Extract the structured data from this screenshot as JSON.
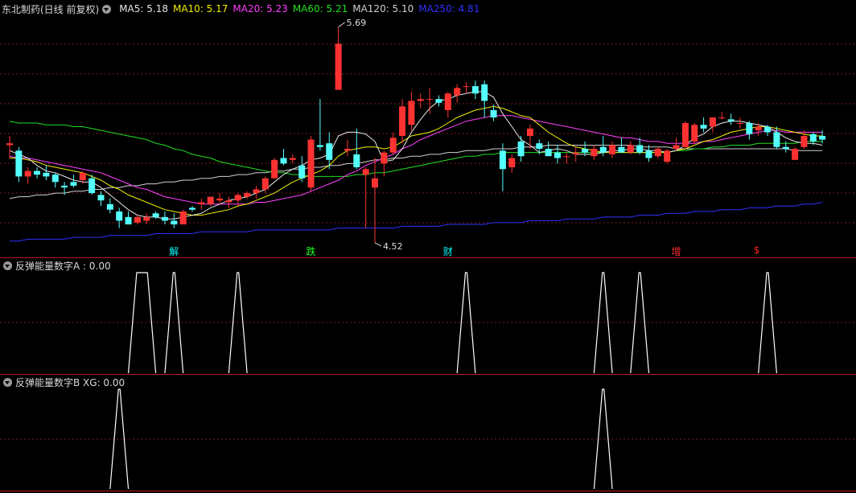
{
  "main_panel": {
    "title": "东北制药(日线 前复权)",
    "ma_legend": [
      {
        "label": "MA5: 5.18",
        "color": "#e8e8e8"
      },
      {
        "label": "MA10: 5.17",
        "color": "#f0f000"
      },
      {
        "label": "MA20: 5.23",
        "color": "#ff40ff"
      },
      {
        "label": "MA60: 5.21",
        "color": "#20e020"
      },
      {
        "label": "MA120: 5.10",
        "color": "#d0d0d0"
      },
      {
        "label": "MA250: 4.81",
        "color": "#3030ff"
      }
    ],
    "high_label": "5.69",
    "low_label": "4.52",
    "event_labels": [
      {
        "text": "解",
        "color": "#00ffff"
      },
      {
        "text": "跌",
        "color": "#20ff20"
      },
      {
        "text": "财",
        "color": "#00ffff"
      },
      {
        "text": "增",
        "color": "#ff3030"
      },
      {
        "text": "$",
        "color": "#ff2020"
      }
    ]
  },
  "indicator_a": {
    "title": "反弹能量数字A : 0.00"
  },
  "indicator_b": {
    "title": "反弹能量数字B  XG: 0.00"
  },
  "colors": {
    "up": "#ff3232",
    "down": "#54ffff",
    "grid": "#7a1e1e",
    "separator": "#b01818",
    "indicator_line": "#ffffff"
  },
  "chart_data": [
    {
      "type": "candlestick",
      "price_range": [
        4.45,
        5.75
      ],
      "candles": [
        [
          5.05,
          5.1,
          4.98,
          5.06
        ],
        [
          5.02,
          5.04,
          4.85,
          4.88
        ],
        [
          4.88,
          4.93,
          4.84,
          4.91
        ],
        [
          4.91,
          4.93,
          4.87,
          4.89
        ],
        [
          4.9,
          4.94,
          4.86,
          4.88
        ],
        [
          4.89,
          4.9,
          4.82,
          4.85
        ],
        [
          4.83,
          4.85,
          4.78,
          4.82
        ],
        [
          4.85,
          4.89,
          4.82,
          4.83
        ],
        [
          4.86,
          4.91,
          4.84,
          4.9
        ],
        [
          4.87,
          4.89,
          4.78,
          4.79
        ],
        [
          4.78,
          4.8,
          4.72,
          4.75
        ],
        [
          4.73,
          4.76,
          4.68,
          4.7
        ],
        [
          4.69,
          4.71,
          4.6,
          4.64
        ],
        [
          4.66,
          4.69,
          4.62,
          4.62
        ],
        [
          4.63,
          4.67,
          4.62,
          4.66
        ],
        [
          4.64,
          4.68,
          4.62,
          4.66
        ],
        [
          4.68,
          4.69,
          4.65,
          4.66
        ],
        [
          4.66,
          4.69,
          4.62,
          4.64
        ],
        [
          4.64,
          4.68,
          4.6,
          4.62
        ],
        [
          4.62,
          4.7,
          4.62,
          4.69
        ],
        [
          4.71,
          4.72,
          4.69,
          4.7
        ],
        [
          4.73,
          4.76,
          4.7,
          4.74
        ],
        [
          4.73,
          4.77,
          4.72,
          4.77
        ],
        [
          4.75,
          4.79,
          4.73,
          4.76
        ],
        [
          4.74,
          4.77,
          4.71,
          4.75
        ],
        [
          4.75,
          4.79,
          4.72,
          4.78
        ],
        [
          4.77,
          4.8,
          4.76,
          4.79
        ],
        [
          4.79,
          4.83,
          4.76,
          4.81
        ],
        [
          4.81,
          4.88,
          4.79,
          4.87
        ],
        [
          4.87,
          4.98,
          4.87,
          4.97
        ],
        [
          4.98,
          5.03,
          4.94,
          4.95
        ],
        [
          4.97,
          5.0,
          4.95,
          4.98
        ],
        [
          4.94,
          4.99,
          4.85,
          4.87
        ],
        [
          4.82,
          5.1,
          4.8,
          5.08
        ],
        [
          5.05,
          5.3,
          5.02,
          5.04
        ],
        [
          5.06,
          5.12,
          4.92,
          4.97
        ],
        [
          5.35,
          5.69,
          5.35,
          5.6
        ],
        [
          5.02,
          5.08,
          4.99,
          5.03
        ],
        [
          5.0,
          5.14,
          4.92,
          4.93
        ],
        [
          4.89,
          4.93,
          4.6,
          4.92
        ],
        [
          4.82,
          4.98,
          4.52,
          4.87
        ],
        [
          4.95,
          5.02,
          4.88,
          5.01
        ],
        [
          5.01,
          5.12,
          5.0,
          5.09
        ],
        [
          5.1,
          5.3,
          5.06,
          5.26
        ],
        [
          5.16,
          5.34,
          5.13,
          5.29
        ],
        [
          5.29,
          5.33,
          5.25,
          5.3
        ],
        [
          5.3,
          5.36,
          5.22,
          5.3
        ],
        [
          5.3,
          5.32,
          5.26,
          5.28
        ],
        [
          5.24,
          5.34,
          5.2,
          5.33
        ],
        [
          5.32,
          5.38,
          5.28,
          5.36
        ],
        [
          5.37,
          5.39,
          5.33,
          5.37
        ],
        [
          5.37,
          5.4,
          5.3,
          5.33
        ],
        [
          5.38,
          5.4,
          5.2,
          5.29
        ],
        [
          5.24,
          5.27,
          5.18,
          5.2
        ],
        [
          5.02,
          5.06,
          4.8,
          4.92
        ],
        [
          4.93,
          5.0,
          4.9,
          4.98
        ],
        [
          5.07,
          5.1,
          4.96,
          4.99
        ],
        [
          5.1,
          5.16,
          5.03,
          5.14
        ],
        [
          5.06,
          5.08,
          5.0,
          5.03
        ],
        [
          5.03,
          5.07,
          4.99,
          4.99
        ],
        [
          5.01,
          5.05,
          4.95,
          4.98
        ],
        [
          4.99,
          5.01,
          4.95,
          4.99
        ],
        [
          5.0,
          5.04,
          4.96,
          5.01
        ],
        [
          5.03,
          5.07,
          4.99,
          5.01
        ],
        [
          4.99,
          5.05,
          4.97,
          5.03
        ],
        [
          5.04,
          5.1,
          4.99,
          5.01
        ],
        [
          5.0,
          5.07,
          4.98,
          5.05
        ],
        [
          5.04,
          5.09,
          5.01,
          5.01
        ],
        [
          5.01,
          5.07,
          5.0,
          5.05
        ],
        [
          5.05,
          5.09,
          5.0,
          5.01
        ],
        [
          5.02,
          5.05,
          4.96,
          4.98
        ],
        [
          4.99,
          5.04,
          4.98,
          5.03
        ],
        [
          4.96,
          5.03,
          4.95,
          5.02
        ],
        [
          5.03,
          5.09,
          5.02,
          5.05
        ],
        [
          5.04,
          5.18,
          5.03,
          5.17
        ],
        [
          5.07,
          5.17,
          5.06,
          5.16
        ],
        [
          5.16,
          5.2,
          5.12,
          5.14
        ],
        [
          5.15,
          5.2,
          5.12,
          5.2
        ],
        [
          5.2,
          5.23,
          5.19,
          5.2
        ],
        [
          5.19,
          5.22,
          5.16,
          5.18
        ],
        [
          5.17,
          5.2,
          5.14,
          5.17
        ],
        [
          5.17,
          5.18,
          5.08,
          5.11
        ],
        [
          5.13,
          5.17,
          5.1,
          5.15
        ],
        [
          5.15,
          5.16,
          5.1,
          5.12
        ],
        [
          5.12,
          5.15,
          5.03,
          5.04
        ],
        [
          5.04,
          5.07,
          5.01,
          5.03
        ],
        [
          4.97,
          5.04,
          4.97,
          5.03
        ],
        [
          5.04,
          5.13,
          5.03,
          5.1
        ],
        [
          5.11,
          5.12,
          5.05,
          5.07
        ],
        [
          5.1,
          5.13,
          5.06,
          5.08
        ]
      ],
      "ma_series": [
        {
          "name": "MA5",
          "values": [
            5.02,
            5.0,
            4.98,
            4.94,
            4.91,
            4.9,
            4.88,
            4.86,
            4.85,
            4.85,
            4.82,
            4.78,
            4.74,
            4.7,
            4.67,
            4.66,
            4.66,
            4.65,
            4.65,
            4.66,
            4.67,
            4.68,
            4.71,
            4.73,
            4.75,
            4.76,
            4.77,
            4.79,
            4.81,
            4.85,
            4.89,
            4.92,
            4.94,
            4.97,
            4.98,
            5.0,
            5.1,
            5.12,
            5.12,
            5.11,
            5.07,
            4.96,
            4.97,
            5.03,
            5.12,
            5.19,
            5.25,
            5.29,
            5.3,
            5.32,
            5.33,
            5.34,
            5.34,
            5.31,
            5.22,
            5.15,
            5.08,
            5.05,
            5.01,
            5.02,
            5.03,
            5.02,
            5.0,
            5.0,
            5.0,
            5.01,
            5.02,
            5.02,
            5.03,
            5.03,
            5.02,
            5.02,
            5.01,
            5.02,
            5.05,
            5.09,
            5.11,
            5.15,
            5.17,
            5.18,
            5.18,
            5.17,
            5.16,
            5.15,
            5.12,
            5.09,
            5.07,
            5.06,
            5.06,
            5.05
          ]
        },
        {
          "name": "MA10",
          "values": [
            4.98,
            4.98,
            4.97,
            4.96,
            4.94,
            4.93,
            4.92,
            4.91,
            4.9,
            4.88,
            4.86,
            4.83,
            4.81,
            4.78,
            4.76,
            4.74,
            4.72,
            4.7,
            4.69,
            4.68,
            4.67,
            4.67,
            4.68,
            4.69,
            4.7,
            4.72,
            4.73,
            4.75,
            4.77,
            4.79,
            4.82,
            4.85,
            4.87,
            4.89,
            4.91,
            4.94,
            4.99,
            5.02,
            5.03,
            5.04,
            5.04,
            5.03,
            5.04,
            5.07,
            5.1,
            5.11,
            5.12,
            5.14,
            5.17,
            5.2,
            5.22,
            5.24,
            5.25,
            5.26,
            5.25,
            5.23,
            5.21,
            5.2,
            5.16,
            5.12,
            5.09,
            5.06,
            5.04,
            5.03,
            5.02,
            5.01,
            5.01,
            5.01,
            5.01,
            5.01,
            5.01,
            5.01,
            5.01,
            5.02,
            5.03,
            5.05,
            5.07,
            5.08,
            5.1,
            5.12,
            5.13,
            5.14,
            5.15,
            5.15,
            5.14,
            5.13,
            5.12,
            5.11,
            5.1,
            5.1
          ]
        },
        {
          "name": "MA20",
          "values": [
            4.99,
            4.98,
            4.98,
            4.97,
            4.96,
            4.95,
            4.94,
            4.93,
            4.92,
            4.91,
            4.9,
            4.88,
            4.86,
            4.84,
            4.82,
            4.81,
            4.79,
            4.77,
            4.76,
            4.75,
            4.74,
            4.73,
            4.73,
            4.73,
            4.73,
            4.73,
            4.73,
            4.74,
            4.74,
            4.75,
            4.76,
            4.77,
            4.78,
            4.8,
            4.82,
            4.84,
            4.86,
            4.89,
            4.91,
            4.94,
            4.96,
            4.98,
            5.0,
            5.03,
            5.05,
            5.08,
            5.1,
            5.12,
            5.14,
            5.16,
            5.18,
            5.19,
            5.2,
            5.21,
            5.21,
            5.21,
            5.2,
            5.19,
            5.18,
            5.17,
            5.16,
            5.15,
            5.14,
            5.13,
            5.12,
            5.11,
            5.1,
            5.09,
            5.09,
            5.08,
            5.07,
            5.07,
            5.06,
            5.06,
            5.06,
            5.06,
            5.07,
            5.07,
            5.08,
            5.09,
            5.1,
            5.11,
            5.12,
            5.13,
            5.13,
            5.12,
            5.12,
            5.12,
            5.12,
            5.12
          ]
        },
        {
          "name": "MA60",
          "values": [
            5.18,
            5.17,
            5.17,
            5.17,
            5.16,
            5.16,
            5.16,
            5.15,
            5.15,
            5.14,
            5.13,
            5.12,
            5.11,
            5.1,
            5.09,
            5.08,
            5.06,
            5.05,
            5.03,
            5.02,
            5.0,
            4.99,
            4.98,
            4.96,
            4.95,
            4.94,
            4.93,
            4.92,
            4.91,
            4.9,
            4.9,
            4.89,
            4.89,
            4.88,
            4.88,
            4.88,
            4.88,
            4.88,
            4.89,
            4.89,
            4.9,
            4.9,
            4.91,
            4.92,
            4.93,
            4.94,
            4.95,
            4.96,
            4.97,
            4.98,
            4.99,
            4.99,
            5.0,
            5.0,
            5.01,
            5.01,
            5.01,
            5.01,
            5.01,
            5.01,
            5.01,
            5.01,
            5.01,
            5.01,
            5.01,
            5.01,
            5.01,
            5.01,
            5.01,
            5.01,
            5.01,
            5.01,
            5.01,
            5.02,
            5.02,
            5.03,
            5.03,
            5.04,
            5.04,
            5.05,
            5.05,
            5.05,
            5.06,
            5.06,
            5.06,
            5.06,
            5.06,
            5.07,
            5.07,
            5.07
          ]
        },
        {
          "name": "MA120",
          "values": [
            4.76,
            4.77,
            4.77,
            4.78,
            4.78,
            4.79,
            4.79,
            4.8,
            4.8,
            4.81,
            4.81,
            4.82,
            4.82,
            4.83,
            4.83,
            4.84,
            4.84,
            4.85,
            4.85,
            4.86,
            4.86,
            4.87,
            4.87,
            4.88,
            4.88,
            4.89,
            4.89,
            4.9,
            4.9,
            4.91,
            4.91,
            4.92,
            4.92,
            4.93,
            4.93,
            4.94,
            4.94,
            4.95,
            4.95,
            4.96,
            4.97,
            4.97,
            4.98,
            4.98,
            4.99,
            4.99,
            5.0,
            5.0,
            5.01,
            5.01,
            5.02,
            5.02,
            5.02,
            5.03,
            5.03,
            5.03,
            5.04,
            5.04,
            5.04,
            5.05,
            5.05,
            5.05,
            5.05,
            5.05,
            5.05,
            5.05,
            5.05,
            5.05,
            5.05,
            5.04,
            5.04,
            5.04,
            5.04,
            5.03,
            5.03,
            5.03,
            5.03,
            5.03,
            5.03,
            5.03,
            5.03,
            5.03,
            5.03,
            5.03,
            5.03,
            5.03,
            5.02,
            5.02,
            5.02,
            5.02
          ]
        },
        {
          "name": "MA250",
          "values": [
            4.53,
            4.53,
            4.54,
            4.54,
            4.54,
            4.54,
            4.54,
            4.55,
            4.55,
            4.55,
            4.55,
            4.56,
            4.56,
            4.56,
            4.56,
            4.56,
            4.57,
            4.57,
            4.57,
            4.57,
            4.57,
            4.58,
            4.58,
            4.58,
            4.58,
            4.58,
            4.58,
            4.59,
            4.59,
            4.59,
            4.59,
            4.59,
            4.59,
            4.59,
            4.59,
            4.59,
            4.6,
            4.6,
            4.6,
            4.6,
            4.6,
            4.6,
            4.6,
            4.61,
            4.61,
            4.61,
            4.61,
            4.61,
            4.62,
            4.62,
            4.62,
            4.62,
            4.62,
            4.63,
            4.63,
            4.63,
            4.63,
            4.64,
            4.64,
            4.64,
            4.64,
            4.65,
            4.65,
            4.65,
            4.65,
            4.66,
            4.66,
            4.66,
            4.66,
            4.67,
            4.67,
            4.67,
            4.68,
            4.68,
            4.68,
            4.69,
            4.69,
            4.69,
            4.7,
            4.7,
            4.7,
            4.71,
            4.71,
            4.71,
            4.72,
            4.72,
            4.72,
            4.73,
            4.73,
            4.74
          ]
        }
      ],
      "events": [
        {
          "label": "解",
          "index": 18
        },
        {
          "label": "跌",
          "index": 33
        },
        {
          "label": "财",
          "index": 48
        },
        {
          "label": "增",
          "index": 73
        },
        {
          "label": "$",
          "index": 82
        }
      ]
    },
    {
      "type": "line",
      "name": "反弹能量数字A",
      "range": [
        0,
        1
      ],
      "peaks": [
        [
          14,
          15
        ],
        [
          18
        ],
        [
          25
        ],
        [
          50
        ],
        [
          65
        ],
        [
          69
        ],
        [
          83
        ]
      ]
    },
    {
      "type": "line",
      "name": "反弹能量数字B",
      "range": [
        0,
        1
      ],
      "peaks": [
        [
          12
        ],
        [
          65
        ]
      ]
    }
  ]
}
